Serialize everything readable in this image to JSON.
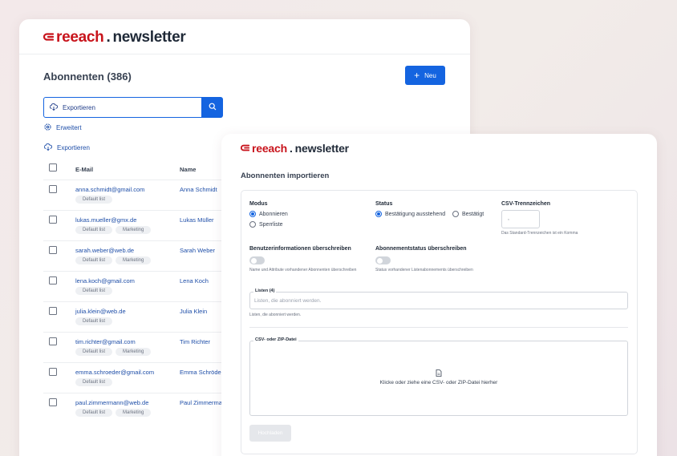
{
  "brand": {
    "mark": "⊃",
    "reach": "reeach",
    "dot": ".",
    "product": "newsletter"
  },
  "subscribers": {
    "title": "Abonnenten (386)",
    "new_button": "Neu",
    "search_value": "Exportieren",
    "advanced_link": "Erweitert",
    "export_link": "Exportieren",
    "columns": {
      "email": "E-Mail",
      "name": "Name"
    },
    "rows": [
      {
        "email": "anna.schmidt@gmail.com",
        "name": "Anna Schmidt",
        "tags": [
          "Default list"
        ]
      },
      {
        "email": "lukas.mueller@gmx.de",
        "name": "Lukas Müller",
        "tags": [
          "Default list",
          "Marketing"
        ]
      },
      {
        "email": "sarah.weber@web.de",
        "name": "Sarah Weber",
        "tags": [
          "Default list",
          "Marketing"
        ]
      },
      {
        "email": "lena.koch@gmail.com",
        "name": "Lena Koch",
        "tags": [
          "Default list"
        ]
      },
      {
        "email": "julia.klein@web.de",
        "name": "Julia Klein",
        "tags": [
          "Default list"
        ]
      },
      {
        "email": "tim.richter@gmail.com",
        "name": "Tim Richter",
        "tags": [
          "Default list",
          "Marketing"
        ]
      },
      {
        "email": "emma.schroeder@gmail.com",
        "name": "Emma Schröder",
        "tags": [
          "Default list"
        ]
      },
      {
        "email": "paul.zimmermann@web.de",
        "name": "Paul Zimmermann",
        "tags": [
          "Default list",
          "Marketing"
        ]
      }
    ]
  },
  "import": {
    "title": "Abonnenten importieren",
    "mode": {
      "label": "Modus",
      "options": [
        "Abonnieren",
        "Sperrliste"
      ],
      "selected": "Abonnieren"
    },
    "status": {
      "label": "Status",
      "options": [
        "Bestätigung ausstehend",
        "Bestätigt"
      ],
      "selected": "Bestätigung ausstehend"
    },
    "csv_delimiter": {
      "label": "CSV-Trennzeichen",
      "value": ",",
      "hint": "Das Standard-Trennzeichen ist ein Komma"
    },
    "overwrite_userinfo": {
      "label": "Benutzerinformationen überschreiben",
      "hint": "Name und Attribute vorhandener Abonnenten überschreiben",
      "enabled": false
    },
    "overwrite_status": {
      "label": "Abonnementstatus überschreiben",
      "hint": "Status vorhandener Listenabonnements überschreiben",
      "enabled": false
    },
    "lists": {
      "legend": "Listen (4)",
      "placeholder": "Listen, die abonniert werden.",
      "hint": "Listen, die abonniert werden."
    },
    "file": {
      "legend": "CSV- oder ZIP-Datei",
      "prompt": "Klicke oder ziehe eine CSV- oder ZIP-Datei hierher"
    },
    "upload_button": "Hochladen"
  },
  "colors": {
    "brand_red": "#c8141c",
    "primary_blue": "#1464e0",
    "link_blue": "#1e4ea8"
  }
}
